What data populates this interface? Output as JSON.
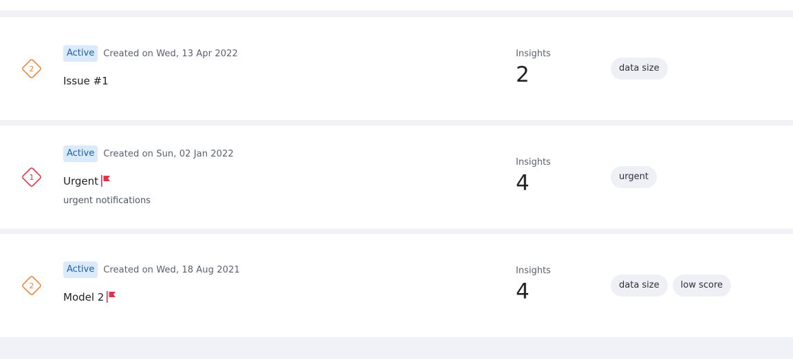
{
  "colors": {
    "page_background": "#f1f2f7",
    "card_background": "#ffffff",
    "badge_background": "#dbeafb",
    "badge_text": "#1b5fa8",
    "severity_2": "#f0843a",
    "severity_1": "#e0344c",
    "flag": "#e0344c"
  },
  "issues": [
    {
      "severity": "2",
      "severity_icon": "diamond-severity-icon",
      "status": "Active",
      "created": "Created on Wed, 13 Apr 2022",
      "title": "Issue #1",
      "flagged": false,
      "description": "",
      "insights_label": "Insights",
      "insights_count": "2",
      "tags": [
        "data size"
      ]
    },
    {
      "severity": "1",
      "severity_icon": "diamond-severity-icon",
      "status": "Active",
      "created": "Created on Sun, 02 Jan 2022",
      "title": "Urgent",
      "flagged": true,
      "flag_icon": "flag-icon",
      "description": "urgent notifications",
      "insights_label": "Insights",
      "insights_count": "4",
      "tags": [
        "urgent"
      ]
    },
    {
      "severity": "2",
      "severity_icon": "diamond-severity-icon",
      "status": "Active",
      "created": "Created on Wed, 18 Aug 2021",
      "title": "Model 2",
      "flagged": true,
      "flag_icon": "flag-icon",
      "description": "",
      "insights_label": "Insights",
      "insights_count": "4",
      "tags": [
        "data size",
        "low score"
      ]
    }
  ]
}
